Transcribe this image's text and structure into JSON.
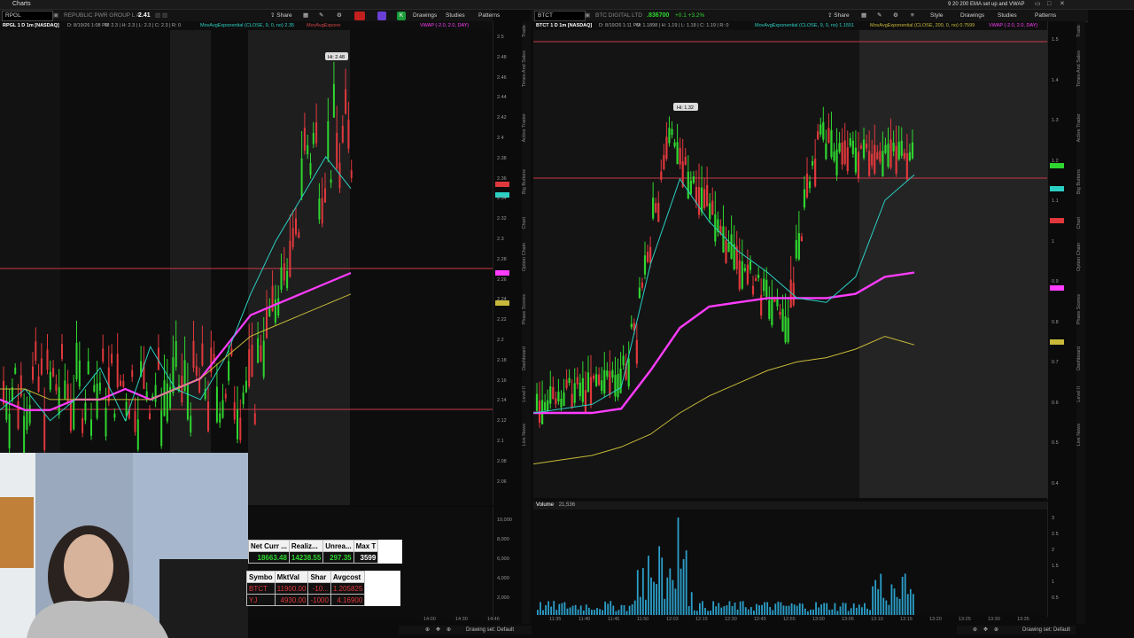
{
  "window": {
    "title": "Charts",
    "top_right_note": "9 20 200 EMA set up and VWAP"
  },
  "left": {
    "symbol": "RPGL",
    "company": "REPUBLIC PWR GROUP L A",
    "last": "2.41",
    "toolbar": {
      "share": "Share",
      "drawings": "Drawings",
      "studies": "Studies",
      "patterns": "Patterns"
    },
    "info": {
      "symbol_line": "RPGL 1 D 1m [NASDAQ]",
      "date": "D: 8/19/26 1:08 PM",
      "ohlc": "O: 2.3 | H: 2.3 | L: 2.3 | C: 2.3 | R: 0",
      "study1": "MovAvgExponential (CLOSE, 9, 0, no)  2.35",
      "study2": "MovAvgExpone",
      "study3": "VWAP (-2.0, 2.0, DAY)"
    },
    "hi_label": "Hi: 2.48",
    "price_ticks": [
      "2.5",
      "2.48",
      "2.46",
      "2.44",
      "2.42",
      "2.4",
      "2.38",
      "2.36",
      "2.34",
      "2.32",
      "2.3",
      "2.28",
      "2.26",
      "2.24",
      "2.22",
      "2.2",
      "2.18",
      "2.16",
      "2.14",
      "2.12",
      "2.1",
      "2.08",
      "2.06"
    ],
    "vol_ticks": [
      "10,000",
      "8,000",
      "6,000",
      "4,000",
      "2,000"
    ],
    "time_ticks": [
      "14:00",
      "14:30",
      "14:46"
    ],
    "status": "Drawing set: Default",
    "side_tabs": [
      "Trade",
      "Times And Sales",
      "Active Trader",
      "Big Buttons",
      "Chart",
      "Option Chain",
      "Phase Scores",
      "Dashboard",
      "Level II",
      "Live News"
    ]
  },
  "right": {
    "symbol": "BTCT",
    "company": "BTC DIGITAL LTD",
    "last": ".836700",
    "change": "+0.1 +3.2%",
    "toolbar": {
      "share": "Share",
      "style": "Style",
      "drawings": "Drawings",
      "studies": "Studies",
      "patterns": "Patterns"
    },
    "info": {
      "symbol_line": "BTCT 1 D 1m [NASDAQ]",
      "date": "D: 8/19/26 1:11 PM",
      "ohlc": "O: 1.1898 | H: 1.19 | L: 1.18 | C: 1.19 | R: 0",
      "study1": "MovAvgExponential (CLOSE, 9, 0, no)  1.1551",
      "study2": "MovAvgExponential (CLOSE, 200, 0, no)  0.7599",
      "study3": "VWAP (-2.0, 2.0, DAY)"
    },
    "hi_label": "Hi: 1.32",
    "price_ticks": [
      "1.5",
      "1.4",
      "1.3",
      "1.2",
      "1.1",
      "1",
      "0.9",
      "0.8",
      "0.7",
      "0.6",
      "0.5",
      "0.4"
    ],
    "volume_label": "Volume",
    "volume_value": "21,536",
    "vol_ticks": [
      "3",
      "2.5",
      "2",
      "1.5",
      "1",
      "0.5"
    ],
    "time_ticks": [
      "11:35",
      "11:40",
      "11:45",
      "11:50",
      "12:03",
      "12:15",
      "12:30",
      "12:45",
      "12:55",
      "13:00",
      "13:05",
      "13:10",
      "13:15",
      "13:20",
      "13:25",
      "13:30",
      "13:35"
    ],
    "status": "Drawing set: Default",
    "side_tabs": [
      "Trade",
      "Times And Sales",
      "Active Trader",
      "Big Buttons",
      "Chart",
      "Option Chain",
      "Phase Scores",
      "Dashboard",
      "Level II",
      "Live News"
    ]
  },
  "account": {
    "headers": [
      "Net Curr ...",
      "Realiz...",
      "Unrea...",
      "Max T"
    ],
    "values": [
      "18663.48",
      "14238.55",
      "297.35",
      "3599"
    ]
  },
  "positions": {
    "headers": [
      "Symbo",
      "MktVal",
      "Shar",
      "Avgcost"
    ],
    "rows": [
      [
        "BTCT",
        "11900.00",
        "-10...",
        "1.205825"
      ],
      [
        "YJ",
        "4930.00",
        "-1000",
        "4.16900"
      ]
    ]
  },
  "colors": {
    "up": "#2fd62f",
    "down": "#e0383c",
    "ema9": "#2bd0c4",
    "ema20": "#d24545",
    "ema200": "#c8b93a",
    "vwap": "#ff3cff",
    "volume": "#2b9fc9"
  },
  "chart_data": [
    {
      "type": "line",
      "title": "RPGL 1 D 1m [NASDAQ]",
      "ylim": [
        2.05,
        2.5
      ],
      "series": [
        {
          "name": "VWAP",
          "values": [
            2.15,
            2.14,
            2.14,
            2.15,
            2.15,
            2.16,
            2.15,
            2.16,
            2.17,
            2.2,
            2.23,
            2.24,
            2.25,
            2.26,
            2.27
          ]
        },
        {
          "name": "MovAvgExponential (CLOSE, 9, 0, no)",
          "values": [
            2.14,
            2.16,
            2.13,
            2.15,
            2.18,
            2.13,
            2.2,
            2.16,
            2.15,
            2.19,
            2.25,
            2.3,
            2.34,
            2.38,
            2.35
          ]
        }
      ],
      "annotations": [
        "Hi: 2.48"
      ]
    },
    {
      "type": "line",
      "title": "BTCT 1 D 1m [NASDAQ]",
      "ylim": [
        0.4,
        1.5
      ],
      "series": [
        {
          "name": "VWAP",
          "values": [
            0.6,
            0.6,
            0.6,
            0.61,
            0.7,
            0.8,
            0.85,
            0.86,
            0.87,
            0.87,
            0.87,
            0.88,
            0.92,
            0.93
          ]
        },
        {
          "name": "MovAvgExponential (CLOSE, 200, 0, no)",
          "values": [
            0.48,
            0.49,
            0.5,
            0.52,
            0.55,
            0.6,
            0.64,
            0.67,
            0.7,
            0.72,
            0.73,
            0.75,
            0.78,
            0.76
          ]
        },
        {
          "name": "MovAvgExponential (CLOSE, 9, 0, no)",
          "values": [
            0.6,
            0.61,
            0.62,
            0.66,
            0.95,
            1.15,
            1.05,
            0.98,
            0.93,
            0.87,
            0.86,
            0.92,
            1.1,
            1.16
          ]
        }
      ],
      "annotations": [
        "Hi: 1.32"
      ]
    }
  ]
}
